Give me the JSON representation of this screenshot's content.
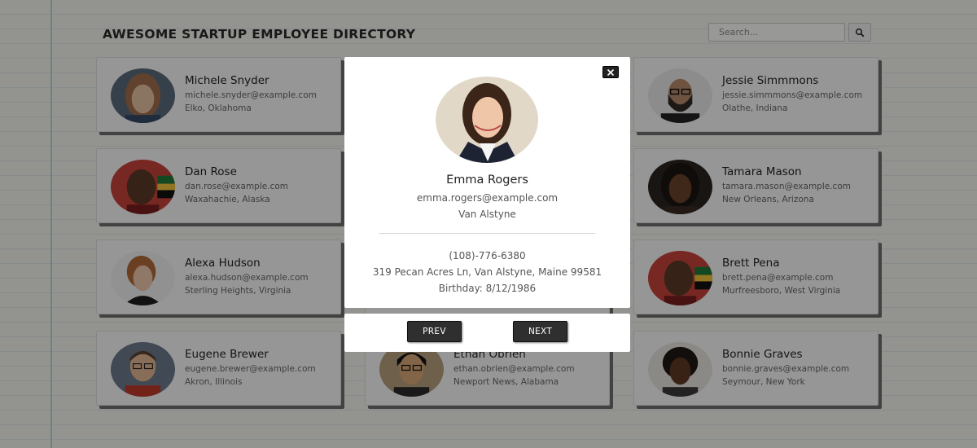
{
  "header": {
    "title": "AWESOME STARTUP EMPLOYEE DIRECTORY"
  },
  "search": {
    "placeholder": "Search..."
  },
  "employees": [
    {
      "name": "Michele Snyder",
      "email": "michele.snyder@example.com",
      "location": "Elko, Oklahoma"
    },
    {
      "name": "Jessie Simmmons",
      "email": "jessie.simmmons@example.com",
      "location": "Olathe, Indiana"
    },
    {
      "name": "Dan Rose",
      "email": "dan.rose@example.com",
      "location": "Waxahachie, Alaska"
    },
    {
      "name": "Tamara Mason",
      "email": "tamara.mason@example.com",
      "location": "New Orleans, Arizona"
    },
    {
      "name": "Alexa Hudson",
      "email": "alexa.hudson@example.com",
      "location": "Sterling Heights, Virginia"
    },
    {
      "name": "Brett Pena",
      "email": "brett.pena@example.com",
      "location": "Murfreesboro, West Virginia"
    },
    {
      "name": "Eugene Brewer",
      "email": "eugene.brewer@example.com",
      "location": "Akron, Illinois"
    },
    {
      "name": "Ethan Obrien",
      "email": "ethan.obrien@example.com",
      "location": "Newport News, Alabama"
    },
    {
      "name": "Bonnie Graves",
      "email": "bonnie.graves@example.com",
      "location": "Seymour, New York"
    }
  ],
  "modal": {
    "close_icon": "close-icon",
    "name": "Emma Rogers",
    "email": "emma.rogers@example.com",
    "city": "Van Alstyne",
    "phone": "(108)-776-6380",
    "address": "319 Pecan Acres Ln, Van Alstyne, Maine 99581",
    "birthday": "Birthday: 8/12/1986",
    "prev_label": "PREV",
    "next_label": "NEXT"
  },
  "colors": {
    "page_background": "#f6f6ee",
    "overlay": "rgba(0,0,0,0.40)",
    "nav_button": "#2f2f2f"
  }
}
